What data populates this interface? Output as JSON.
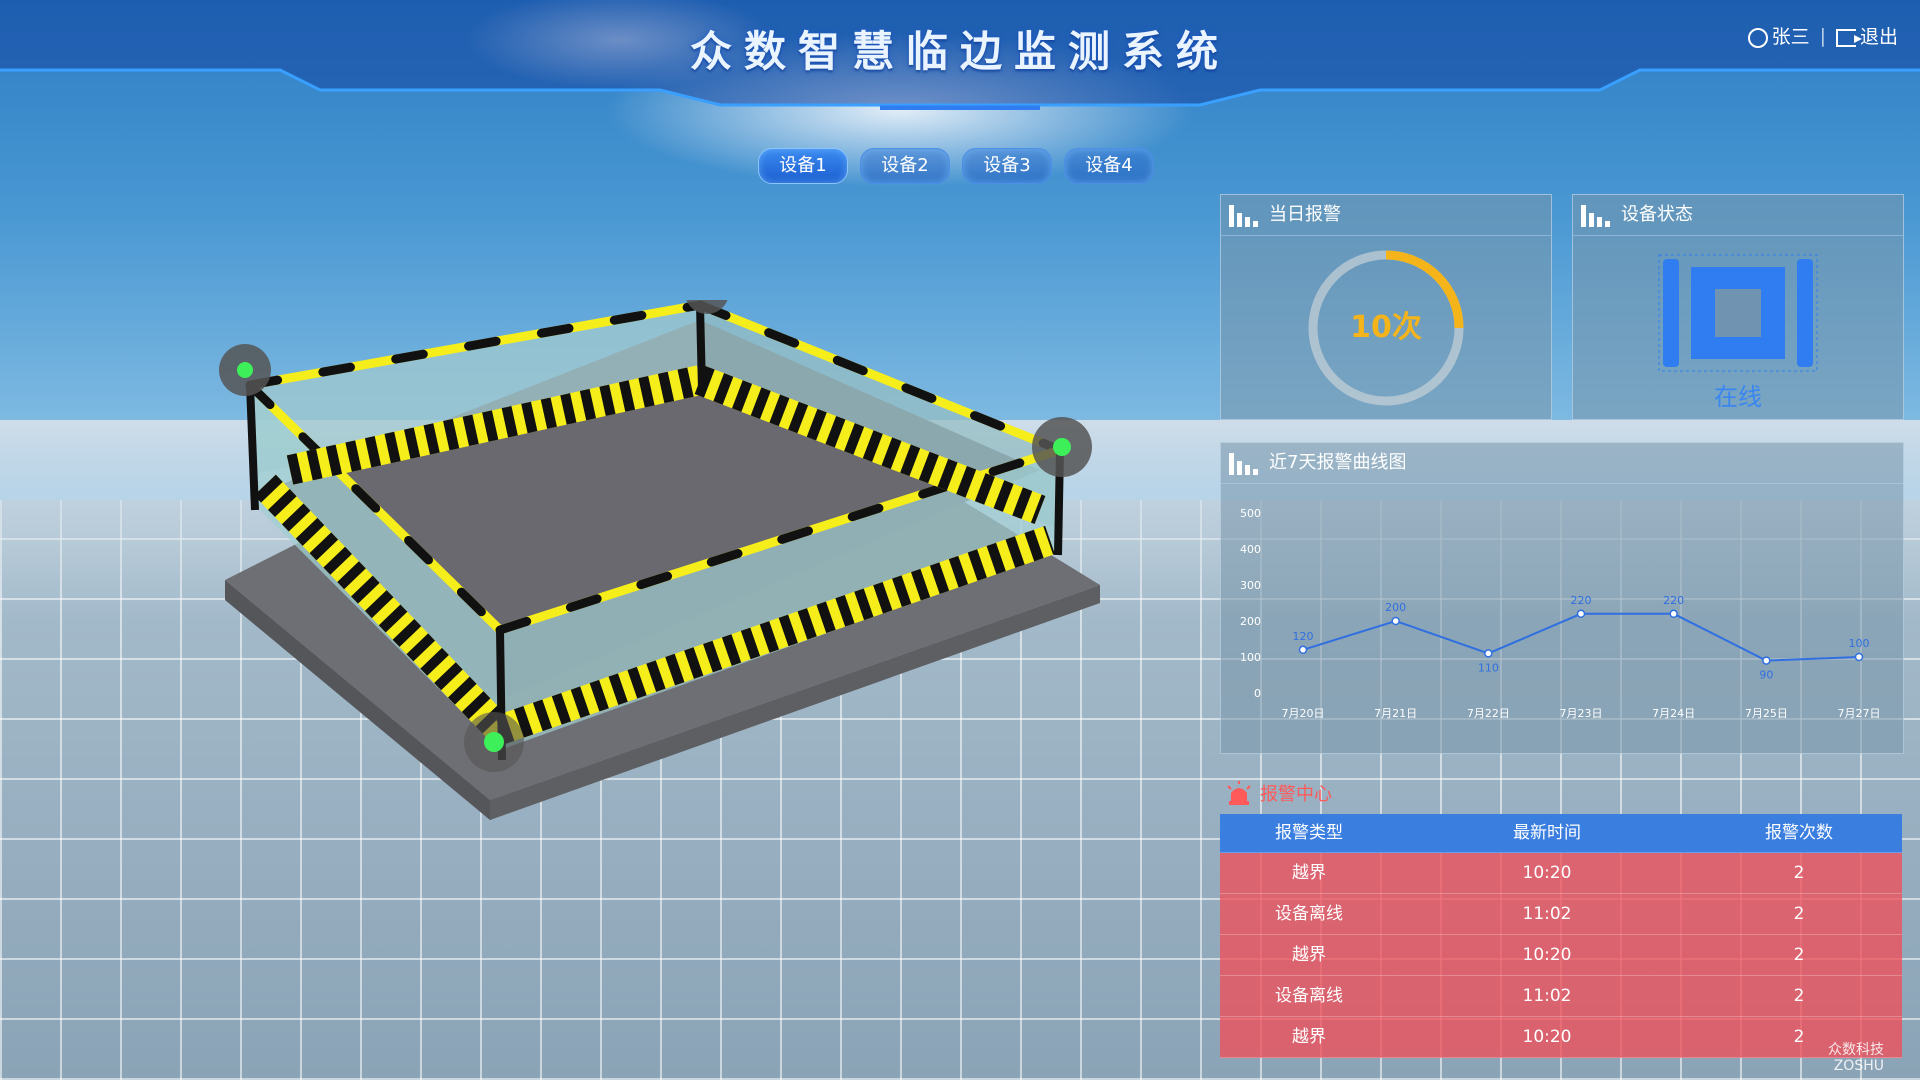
{
  "header": {
    "title": "众数智慧临边监测系统",
    "user_name": "张三",
    "separator": "|",
    "logout_label": "退出"
  },
  "tabs": [
    {
      "label": "设备1",
      "active": true
    },
    {
      "label": "设备2",
      "active": false
    },
    {
      "label": "设备3",
      "active": false
    },
    {
      "label": "设备4",
      "active": false
    }
  ],
  "daily_alarm": {
    "title": "当日报警",
    "value_text": "10次",
    "progress_fraction": 0.25,
    "accent": "#f4b41a"
  },
  "device_status": {
    "title": "设备状态",
    "status_text": "在线",
    "accent": "#2f7df0"
  },
  "trend": {
    "title": "近7天报警曲线图",
    "chart_data": {
      "type": "line",
      "categories": [
        "7月20日",
        "7月21日",
        "7月22日",
        "7月23日",
        "7月24日",
        "7月25日",
        "7月27日"
      ],
      "values": [
        120,
        200,
        110,
        220,
        220,
        90,
        100
      ],
      "y_ticks": [
        0,
        100,
        200,
        300,
        400,
        500
      ],
      "ylim": [
        0,
        500
      ],
      "color": "#2f6fe0"
    }
  },
  "alarm_center": {
    "title": "报警中心",
    "columns": [
      "报警类型",
      "最新时间",
      "报警次数"
    ],
    "rows": [
      [
        "越界",
        "10:20",
        "2"
      ],
      [
        "设备离线",
        "11:02",
        "2"
      ],
      [
        "越界",
        "10:20",
        "2"
      ],
      [
        "设备离线",
        "11:02",
        "2"
      ],
      [
        "越界",
        "10:20",
        "2"
      ]
    ]
  },
  "watermark": {
    "line1": "众数科技",
    "line2": "ZOSHU"
  }
}
